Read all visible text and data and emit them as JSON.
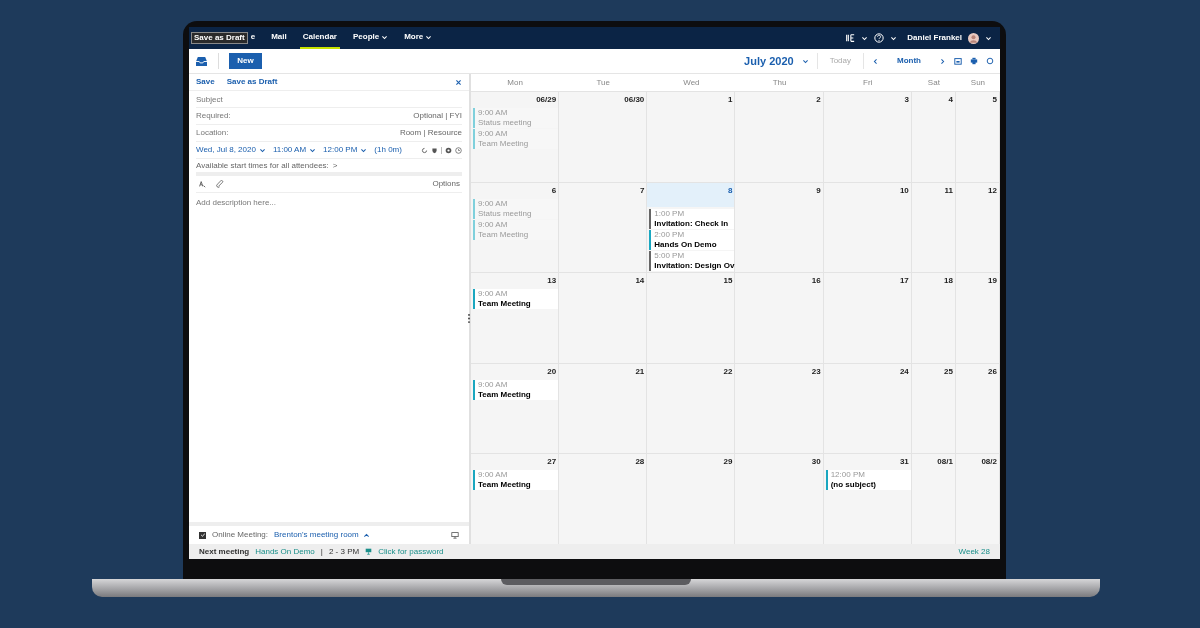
{
  "nav": {
    "tooltip": "Save as Draft",
    "tabs": [
      {
        "label": "e",
        "selected": false,
        "menu": false
      },
      {
        "label": "Mail",
        "selected": false,
        "menu": false
      },
      {
        "label": "Calendar",
        "selected": true,
        "menu": false
      },
      {
        "label": "People",
        "selected": false,
        "menu": true
      },
      {
        "label": "More",
        "selected": false,
        "menu": true
      }
    ],
    "user": "Daniel Frankel"
  },
  "toolbar": {
    "new_button": "New",
    "month_title": "July 2020",
    "today": {
      "label": "Today",
      "disabled": true
    },
    "view": "Month"
  },
  "compose": {
    "actions": [
      "Save",
      "Save as Draft"
    ],
    "subject": {
      "placeholder": "Subject"
    },
    "required": {
      "placeholder": "Required:",
      "extra": "Optional | FYI"
    },
    "location": {
      "placeholder": "Location:",
      "extra": "Room | Resource"
    },
    "date": "Wed, Jul 8, 2020",
    "start": "11:00 AM",
    "end": "12:00 PM",
    "duration": "(1h 0m)",
    "available": "Available start times for all attendees:",
    "available_arrow": ">",
    "options": "Options",
    "description": {
      "placeholder": "Add description here..."
    },
    "online_meeting": {
      "checked": true,
      "label": "Online Meeting:",
      "room": "Brenton's meeting room"
    }
  },
  "calendar": {
    "weekdays": [
      "Mon",
      "Tue",
      "Wed",
      "Thu",
      "Fri",
      "Sat",
      "Sun"
    ],
    "weeks": [
      [
        {
          "label": "06/29",
          "today": false,
          "events": [
            {
              "time": "9:00 AM",
              "title": "Status meeting",
              "past": true,
              "color": "#7fd0dc"
            },
            {
              "time": "9:00 AM",
              "title": "Team Meeting",
              "past": true,
              "color": "#7fd0dc"
            }
          ]
        },
        {
          "label": "06/30",
          "today": false
        },
        {
          "label": "1",
          "today": false
        },
        {
          "label": "2",
          "today": false
        },
        {
          "label": "3",
          "today": false
        },
        {
          "label": "4",
          "today": false
        },
        {
          "label": "5",
          "today": false
        }
      ],
      [
        {
          "label": "6",
          "today": false,
          "events": [
            {
              "time": "9:00 AM",
              "title": "Status meeting",
              "past": true,
              "color": "#7fd0dc"
            },
            {
              "time": "9:00 AM",
              "title": "Team Meeting",
              "past": true,
              "color": "#7fd0dc"
            }
          ]
        },
        {
          "label": "7",
          "today": false
        },
        {
          "label": "8",
          "today": true,
          "events": [
            {
              "time": "1:00 PM",
              "title": "Invitation: Check In",
              "past": false,
              "color": "#666666"
            },
            {
              "time": "2:00 PM",
              "title": "Hands On Demo",
              "past": false,
              "color": "#1aa7c0"
            },
            {
              "time": "5:00 PM",
              "title": "Invitation: Design Ov",
              "past": false,
              "color": "#666666"
            }
          ]
        },
        {
          "label": "9",
          "today": false
        },
        {
          "label": "10",
          "today": false
        },
        {
          "label": "11",
          "today": false
        },
        {
          "label": "12",
          "today": false
        }
      ],
      [
        {
          "label": "13",
          "today": false,
          "events": [
            {
              "time": "9:00 AM",
              "title": "Team Meeting",
              "past": false,
              "color": "#1aa7c0"
            }
          ]
        },
        {
          "label": "14",
          "today": false
        },
        {
          "label": "15",
          "today": false
        },
        {
          "label": "16",
          "today": false
        },
        {
          "label": "17",
          "today": false
        },
        {
          "label": "18",
          "today": false
        },
        {
          "label": "19",
          "today": false
        }
      ],
      [
        {
          "label": "20",
          "today": false,
          "events": [
            {
              "time": "9:00 AM",
              "title": "Team Meeting",
              "past": false,
              "color": "#1aa7c0"
            }
          ]
        },
        {
          "label": "21",
          "today": false
        },
        {
          "label": "22",
          "today": false
        },
        {
          "label": "23",
          "today": false
        },
        {
          "label": "24",
          "today": false
        },
        {
          "label": "25",
          "today": false
        },
        {
          "label": "26",
          "today": false
        }
      ],
      [
        {
          "label": "27",
          "today": false,
          "events": [
            {
              "time": "9:00 AM",
              "title": "Team Meeting",
              "past": false,
              "color": "#1aa7c0"
            }
          ]
        },
        {
          "label": "28",
          "today": false
        },
        {
          "label": "29",
          "today": false
        },
        {
          "label": "30",
          "today": false
        },
        {
          "label": "31",
          "today": false,
          "events": [
            {
              "time": "12:00 PM",
              "title": "(no subject)",
              "past": false,
              "color": "#1aa7c0"
            }
          ]
        },
        {
          "label": "08/1",
          "today": false
        },
        {
          "label": "08/2",
          "today": false
        }
      ]
    ]
  },
  "status_bar": {
    "label": "Next meeting",
    "meeting": "Hands On Demo",
    "separator": "|",
    "time": "2 - 3 PM",
    "link": "Click for password",
    "week": "Week 28"
  }
}
